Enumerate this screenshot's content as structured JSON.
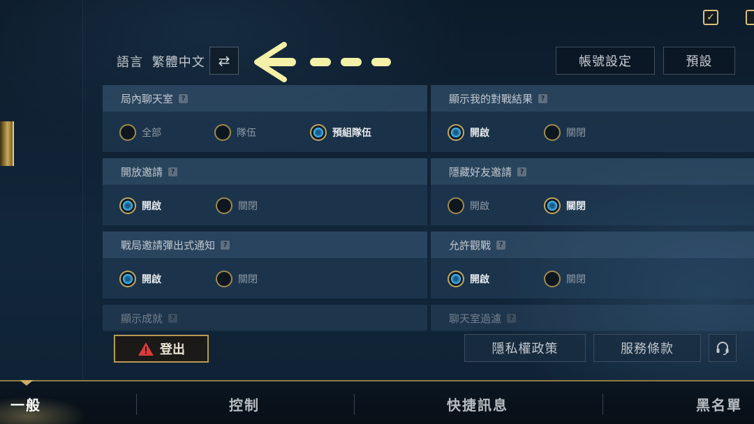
{
  "header": {
    "language_label": "語言",
    "language_value": "繁體中文",
    "account_settings": "帳號設定",
    "default": "預設"
  },
  "panels": {
    "ingame_chat": {
      "title": "局內聊天室",
      "options": [
        "全部",
        "隊伍",
        "預組隊伍"
      ],
      "selected": "預組隊伍"
    },
    "show_match_result": {
      "title": "顯示我的對戰結果",
      "options": [
        "開啟",
        "關閉"
      ],
      "selected": "開啟"
    },
    "open_invite": {
      "title": "開放邀請",
      "options": [
        "開啟",
        "關閉"
      ],
      "selected": "開啟"
    },
    "hide_friend_invite": {
      "title": "隱藏好友邀請",
      "options": [
        "開啟",
        "關閉"
      ],
      "selected": "關閉"
    },
    "match_invite_popup": {
      "title": "戰局邀請彈出式通知",
      "options": [
        "開啟",
        "關閉"
      ],
      "selected": "開啟"
    },
    "allow_spectate": {
      "title": "允許觀戰",
      "options": [
        "開啟",
        "關閉"
      ],
      "selected": "開啟"
    },
    "show_achievements": {
      "title": "顯示成就"
    },
    "chat_filter": {
      "title": "聊天室過濾"
    }
  },
  "footer": {
    "logout": "登出",
    "privacy_policy": "隱私權政策",
    "terms_of_service": "服務條款"
  },
  "tabs": [
    "一般",
    "控制",
    "快捷訊息",
    "黑名單"
  ],
  "active_tab": "一般",
  "colors": {
    "gold_accent": "#c2a85e",
    "radio_selected": "#2f9fd8",
    "warning": "#d83b3b"
  }
}
